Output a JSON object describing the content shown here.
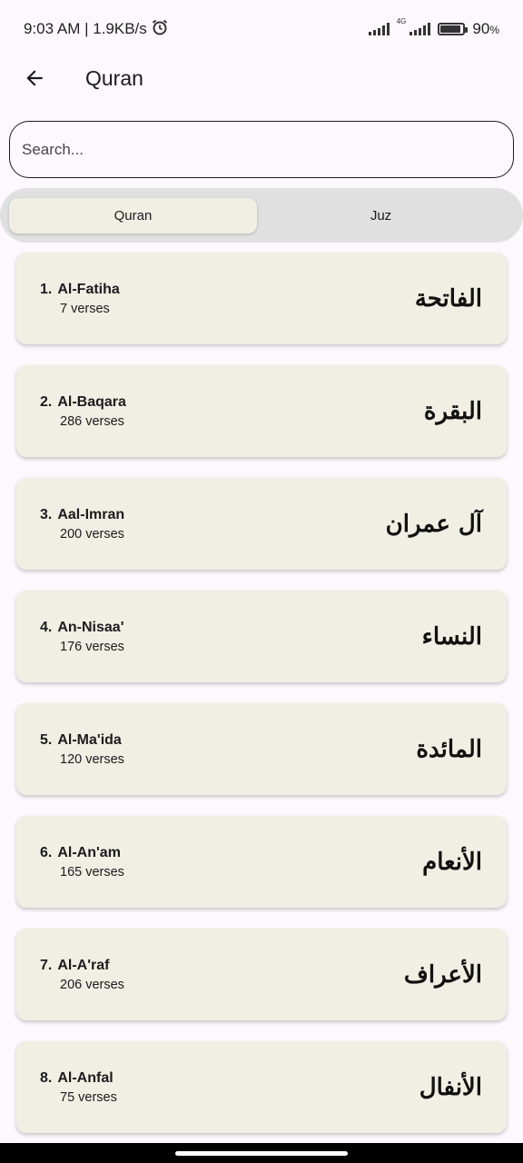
{
  "status": {
    "time_info": "9:03 AM | 1.9KB/s",
    "network_type": "4G",
    "battery_percent": "90",
    "battery_suffix": "%",
    "battery_level": 0.9
  },
  "app_bar": {
    "title": "Quran"
  },
  "search": {
    "placeholder": "Search...",
    "value": ""
  },
  "tabs": [
    {
      "label": "Quran",
      "active": true
    },
    {
      "label": "Juz",
      "active": false
    }
  ],
  "surahs": [
    {
      "number": "1.",
      "name": "Al-Fatiha",
      "verses": "7 verses",
      "arabic": "الفاتحة"
    },
    {
      "number": "2.",
      "name": "Al-Baqara",
      "verses": "286 verses",
      "arabic": "البقرة"
    },
    {
      "number": "3.",
      "name": "Aal-Imran",
      "verses": "200 verses",
      "arabic": "آل عمران"
    },
    {
      "number": "4.",
      "name": "An-Nisaa'",
      "verses": "176 verses",
      "arabic": "النساء"
    },
    {
      "number": "5.",
      "name": "Al-Ma'ida",
      "verses": "120 verses",
      "arabic": "المائدة"
    },
    {
      "number": "6.",
      "name": "Al-An'am",
      "verses": "165 verses",
      "arabic": "الأنعام"
    },
    {
      "number": "7.",
      "name": "Al-A'raf",
      "verses": "206 verses",
      "arabic": "الأعراف"
    },
    {
      "number": "8.",
      "name": "Al-Anfal",
      "verses": "75 verses",
      "arabic": "الأنفال"
    }
  ],
  "icons": {
    "back": "arrow-left-icon",
    "alarm": "alarm-icon",
    "signal": "signal-icon",
    "battery": "battery-icon"
  },
  "colors": {
    "background": "#fdf8fd",
    "card": "#f1eee3",
    "tab_track": "#e0e0e0"
  }
}
